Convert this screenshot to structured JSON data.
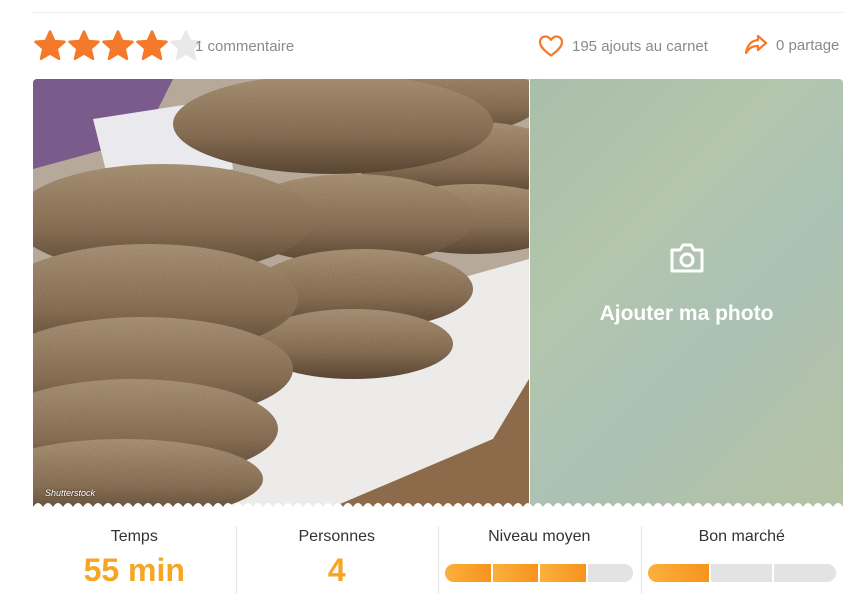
{
  "rating": {
    "value": 4,
    "max": 5,
    "comment_count": "1 commentaire"
  },
  "stats": {
    "carnet": {
      "icon": "heart-icon",
      "label": "195 ajouts au carnet"
    },
    "share": {
      "icon": "share-icon",
      "label": "0 partage"
    }
  },
  "gallery": {
    "photo_alt": "Pains ronds au sésame empilés sur un linge blanc",
    "photo_credit": "Shutterstock",
    "add_photo": {
      "icon": "camera-icon",
      "label": "Ajouter ma photo"
    }
  },
  "info": {
    "time": {
      "label": "Temps",
      "value": "55 min"
    },
    "people": {
      "label": "Personnes",
      "value": "4"
    },
    "difficulty": {
      "label": "Niveau moyen",
      "level": 3,
      "max": 4
    },
    "cost": {
      "label": "Bon marché",
      "level": 1,
      "max": 3
    }
  },
  "colors": {
    "star_filled": "#f5792a",
    "star_empty": "#e9e9e9",
    "accent": "#f5a623",
    "gauge_fill": "#f7931e",
    "gauge_empty": "#e3e3e3"
  }
}
